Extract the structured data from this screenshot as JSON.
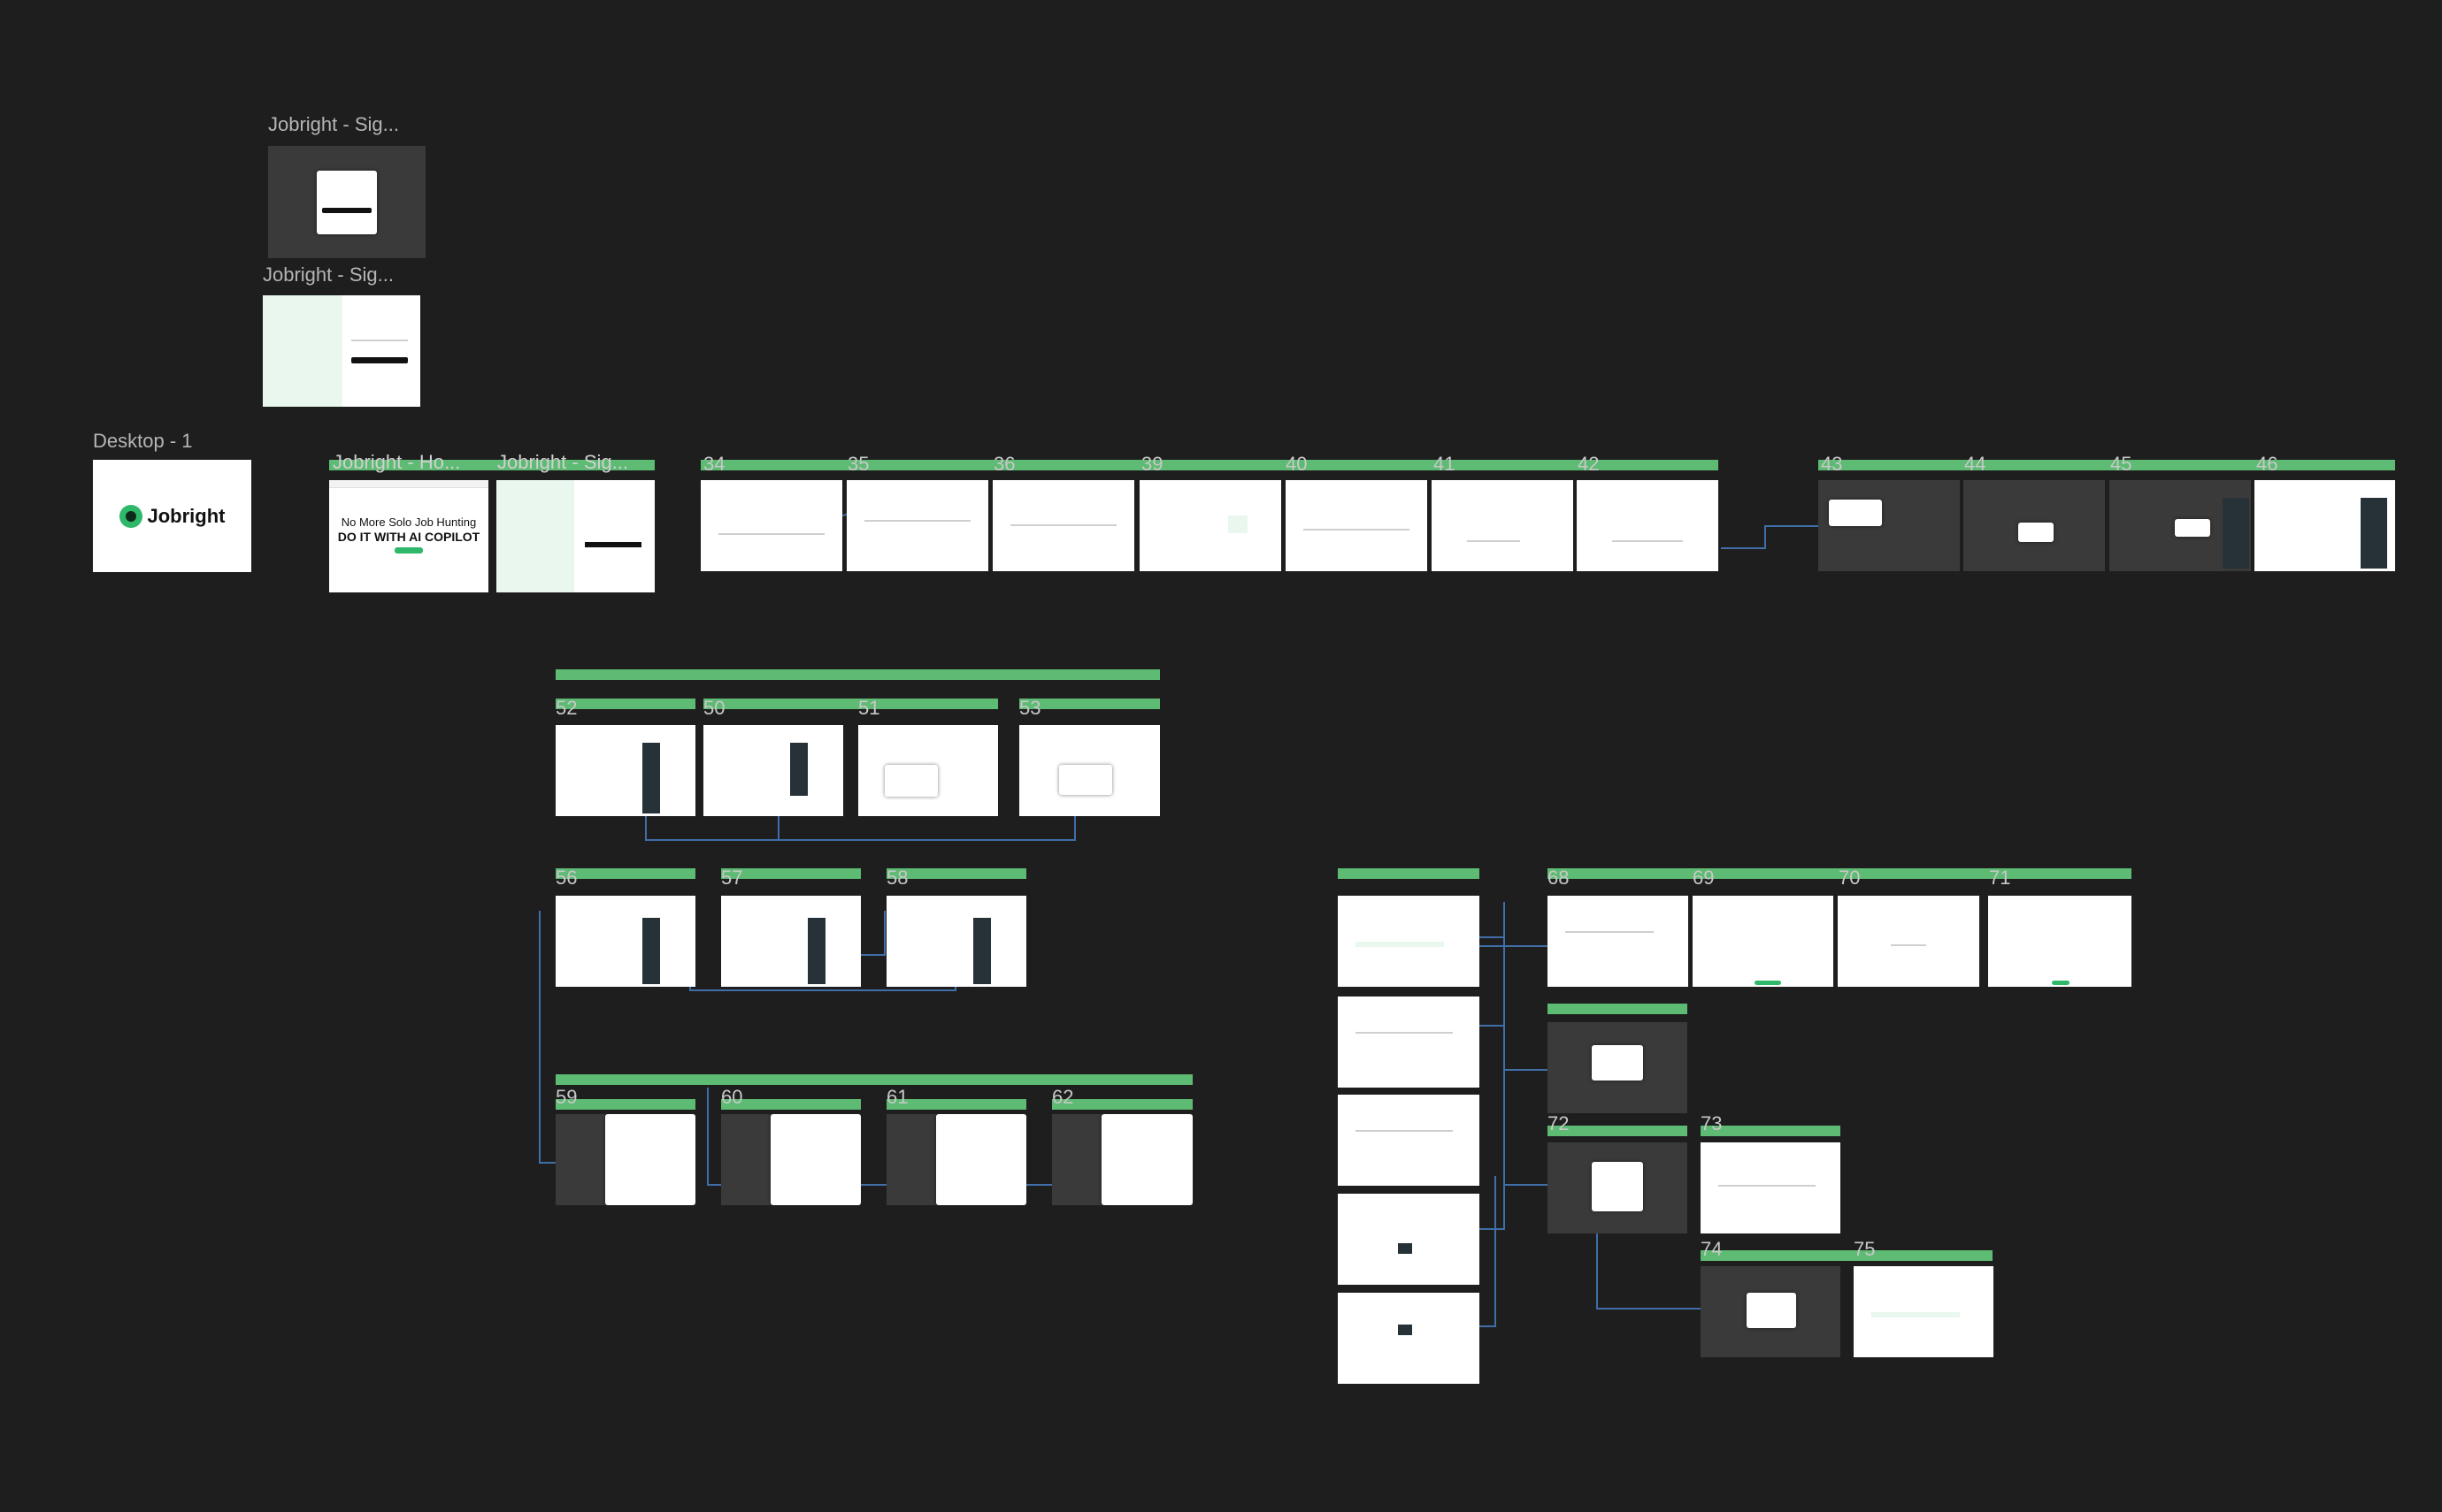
{
  "canvas": {
    "background": "#1e1e1e",
    "accent": "#5dbb73",
    "wire_color": "#3f6ea8"
  },
  "frames": {
    "signin_dark_title": "Jobright - Sig...",
    "signin_light_title": "Jobright - Sig...",
    "desktop1_title": "Desktop - 1",
    "home_title": "Jobright - Ho...",
    "signin_row_title": "Jobright - Sig..."
  },
  "logo": {
    "text": "Jobright",
    "icon": "jobright-logo-icon"
  },
  "home": {
    "headline": "No More Solo Job Hunting",
    "subheadline": "DO IT WITH AI COPILOT"
  },
  "numbers": [
    "34",
    "35",
    "36",
    "39",
    "40",
    "41",
    "42",
    "43",
    "44",
    "45",
    "46",
    "52",
    "50",
    "51",
    "53",
    "56",
    "57",
    "58",
    "59",
    "60",
    "61",
    "62",
    "68",
    "69",
    "70",
    "71",
    "72",
    "73",
    "74",
    "75"
  ]
}
